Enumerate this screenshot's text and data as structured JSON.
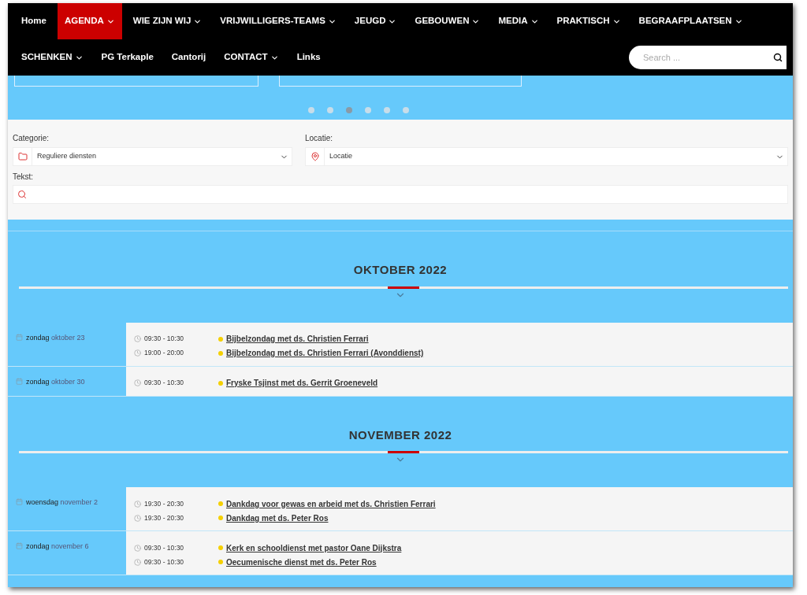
{
  "nav": {
    "row_1": [
      {
        "label": "Home",
        "dropdown": false,
        "selected": false
      },
      {
        "label": "AGENDA",
        "dropdown": true,
        "selected": true
      },
      {
        "label": "WIE ZIJN WIJ",
        "dropdown": true,
        "selected": false
      },
      {
        "label": "VRIJWILLIGERS-TEAMS",
        "dropdown": true,
        "selected": false
      },
      {
        "label": "JEUGD",
        "dropdown": true,
        "selected": false
      },
      {
        "label": "GEBOUWEN",
        "dropdown": true,
        "selected": false
      },
      {
        "label": "MEDIA",
        "dropdown": true,
        "selected": false
      },
      {
        "label": "PRAKTISCH",
        "dropdown": true,
        "selected": false
      },
      {
        "label": "BEGRAAFPLAATSEN",
        "dropdown": true,
        "selected": false
      }
    ],
    "row_2": [
      {
        "label": "SCHENKEN",
        "dropdown": true,
        "selected": false
      },
      {
        "label": "PG Terkaple",
        "dropdown": false,
        "selected": false
      },
      {
        "label": "Cantorij",
        "dropdown": false,
        "selected": false
      },
      {
        "label": "CONTACT",
        "dropdown": true,
        "selected": false
      },
      {
        "label": "Links",
        "dropdown": false,
        "selected": false
      }
    ],
    "search": {
      "placeholder": "Search ..."
    }
  },
  "slider_dots": [
    {
      "selected": false
    },
    {
      "selected": false
    },
    {
      "selected": true
    },
    {
      "selected": false
    },
    {
      "selected": false
    },
    {
      "selected": false
    }
  ],
  "filters": {
    "category": {
      "label": "Categorie:",
      "value": "Reguliere diensten"
    },
    "location": {
      "label": "Locatie:",
      "value": "Locatie"
    },
    "text": {
      "label": "Tekst:"
    }
  },
  "months": [
    {
      "title": "OKTOBER 2022",
      "days": [
        {
          "weekday": "zondag",
          "date": "oktober 23",
          "events": [
            {
              "time": "09:30 - 10:30",
              "title": "Bijbelzondag met ds. Christien Ferrari"
            },
            {
              "time": "19:00 - 20:00",
              "title": "Bijbelzondag met ds. Christien Ferrari (Avonddienst)"
            }
          ]
        },
        {
          "weekday": "zondag",
          "date": "oktober 30",
          "events": [
            {
              "time": "09:30 - 10:30",
              "title": "Fryske Tsjinst met ds. Gerrit Groeneveld"
            }
          ]
        }
      ]
    },
    {
      "title": "NOVEMBER 2022",
      "days": [
        {
          "weekday": "woensdag",
          "date": "november 2",
          "events": [
            {
              "time": "19:30 - 20:30",
              "title": "Dankdag voor gewas en arbeid met ds. Christien Ferrari"
            },
            {
              "time": "19:30 - 20:30",
              "title": "Dankdag met ds. Peter Ros"
            }
          ]
        },
        {
          "weekday": "zondag",
          "date": "november 6",
          "events": [
            {
              "time": "09:30 - 10:30",
              "title": "Kerk en schooldienst met pastor Oane Dijkstra"
            },
            {
              "time": "09:30 - 10:30",
              "title": "Oecumenische dienst met ds. Peter Ros"
            }
          ]
        }
      ]
    }
  ]
}
